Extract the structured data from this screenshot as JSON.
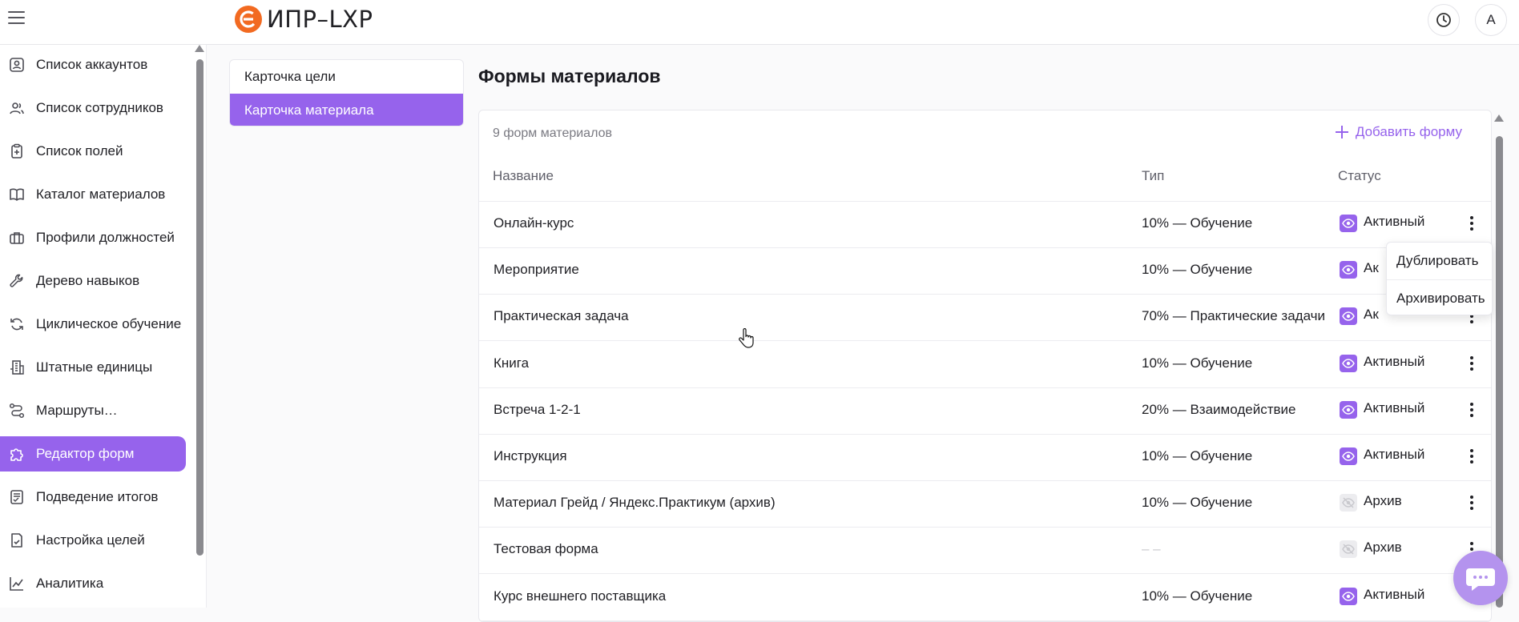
{
  "app": {
    "logo_text": "ИПР–LXP",
    "avatar_letter": "А"
  },
  "sidebar": {
    "items": [
      {
        "label": "Список аккаунтов",
        "icon": "user-card-icon"
      },
      {
        "label": "Список сотрудников",
        "icon": "users-icon"
      },
      {
        "label": "Список полей",
        "icon": "clipboard-icon"
      },
      {
        "label": "Каталог материалов",
        "icon": "book-icon"
      },
      {
        "label": "Профили должностей",
        "icon": "briefcase-icon"
      },
      {
        "label": "Дерево навыков",
        "icon": "wrench-icon"
      },
      {
        "label": "Циклическое обучение",
        "icon": "refresh-icon"
      },
      {
        "label": "Штатные единицы",
        "icon": "building-icon"
      },
      {
        "label": "Маршруты…",
        "icon": "route-icon"
      },
      {
        "label": "Редактор форм",
        "icon": "puzzle-icon",
        "active": true
      },
      {
        "label": "Подведение итогов",
        "icon": "checklist-icon"
      },
      {
        "label": "Настройка целей",
        "icon": "target-doc-icon"
      },
      {
        "label": "Аналитика",
        "icon": "chart-line-icon"
      }
    ]
  },
  "subnav": {
    "items": [
      {
        "label": "Карточка цели"
      },
      {
        "label": "Карточка материала",
        "active": true
      }
    ]
  },
  "main": {
    "title": "Формы материалов",
    "count_label": "9 форм материалов",
    "add_label": "Добавить форму",
    "columns": {
      "name": "Название",
      "type": "Тип",
      "status": "Статус"
    },
    "rows": [
      {
        "name": "Онлайн-курс",
        "type": "10% — Обучение",
        "status": "Активный",
        "active": true
      },
      {
        "name": "Мероприятие",
        "type": "10% — Обучение",
        "status": "Ак",
        "active": true
      },
      {
        "name": "Практическая задача",
        "type": "70% — Практические задачи",
        "status": "Ак",
        "active": true
      },
      {
        "name": "Книга",
        "type": "10% — Обучение",
        "status": "Активный",
        "active": true
      },
      {
        "name": "Встреча 1-2-1",
        "type": "20% — Взаимодействие",
        "status": "Активный",
        "active": true
      },
      {
        "name": "Инструкция",
        "type": "10% — Обучение",
        "status": "Активный",
        "active": true
      },
      {
        "name": "Материал Грейд / Яндекс.Практикум (архив)",
        "type": "10% — Обучение",
        "status": "Архив",
        "active": false
      },
      {
        "name": "Тестовая форма",
        "type": "– –",
        "status": "Архив",
        "active": false
      },
      {
        "name": "Курс внешнего поставщика",
        "type": "10% — Обучение",
        "status": "Активный",
        "active": true
      }
    ]
  },
  "context_menu": {
    "duplicate_label": "Дублировать",
    "archive_label": "Архивировать"
  },
  "colors": {
    "accent": "#9663ec",
    "logo": "#f26a21",
    "fab": "#b493ee"
  }
}
